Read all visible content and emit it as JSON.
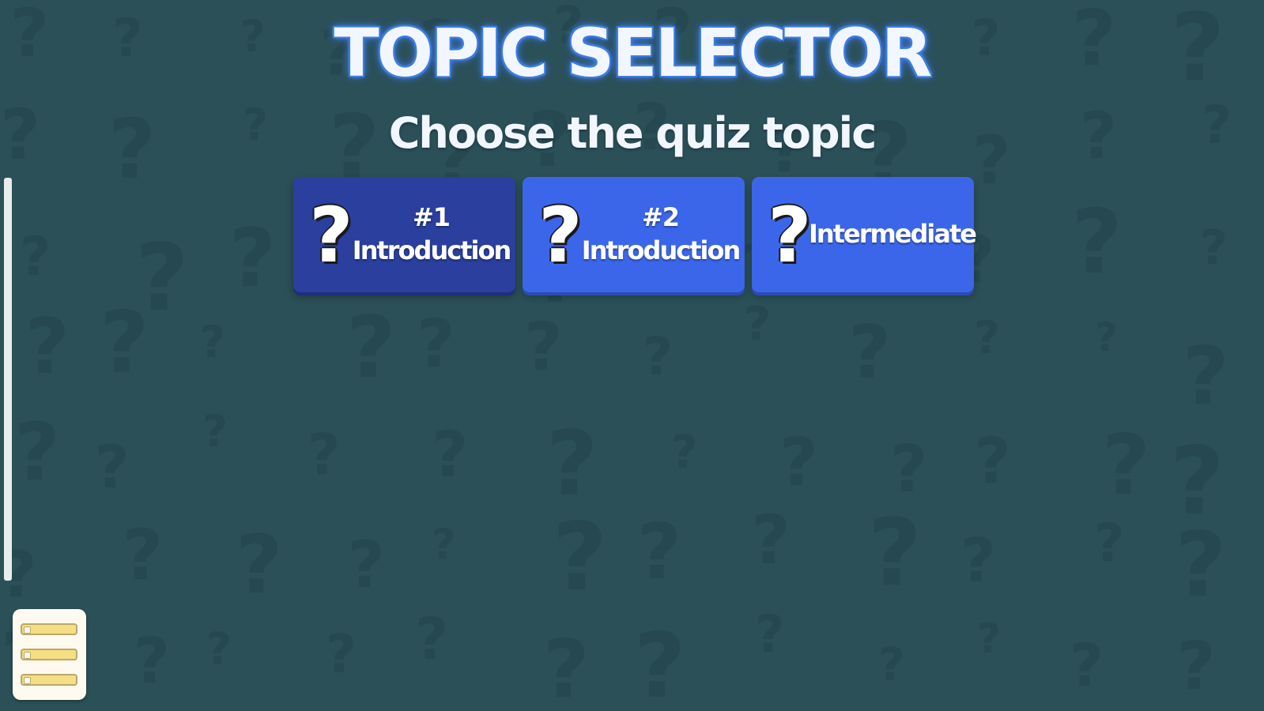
{
  "screen": {
    "title": "TOPIC SELECTOR",
    "subtitle": "Choose the quiz topic"
  },
  "topics": [
    {
      "number": "#1",
      "label": "Introduction",
      "icon": "question-mark-icon",
      "state": "selected"
    },
    {
      "number": "#2",
      "label": "Introduction",
      "icon": "question-mark-icon",
      "state": "default"
    },
    {
      "number": "",
      "label": "Intermediate",
      "icon": "question-mark-icon",
      "state": "default"
    }
  ],
  "menu": {
    "icon": "list-menu-icon"
  },
  "colors": {
    "background": "#2b5058",
    "background_pattern": "#264850",
    "card": "#3c66ea",
    "card_selected": "#2a3f9e",
    "title_glow": "#3f7de6",
    "menu_accent": "#f6de84"
  }
}
